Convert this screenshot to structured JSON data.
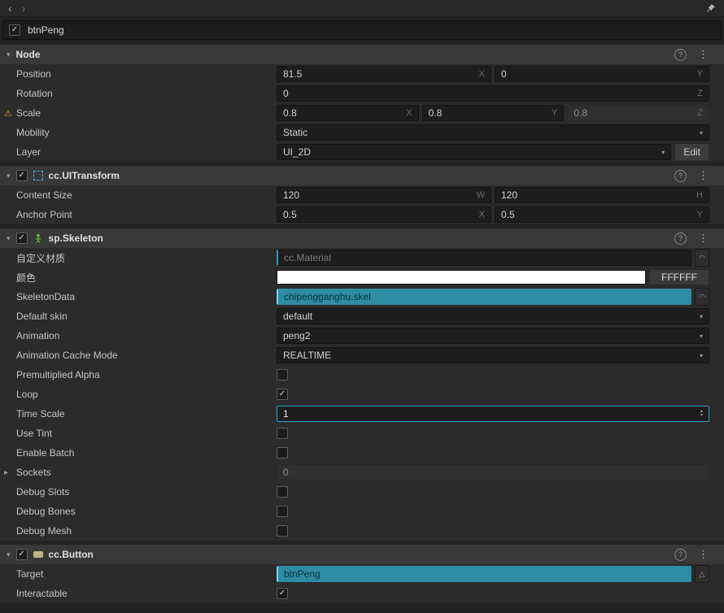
{
  "colors": {
    "accent": "#2aa5c6",
    "asset_reference_bg": "#2e8ca3",
    "warning": "#dba62e",
    "color_swatch": "#ffffff",
    "section_header_bg": "#383838",
    "panel_bg": "#2b2b2b"
  },
  "icons": {
    "back": "‹",
    "forward": "›",
    "chevron_down": "▾",
    "chevron_right": "▸",
    "dots_menu": "⋮",
    "help": "?",
    "check": "✓",
    "warning": "⚠",
    "dropdown_arrow": "▾",
    "stepper_up": "▴",
    "stepper_down": "▾",
    "asset_picker": "◠",
    "node_picker": "△"
  },
  "name_bar": {
    "value": "btnPeng",
    "check": "✓"
  },
  "node": {
    "title": "Node",
    "position": {
      "label": "Position",
      "x": "81.5",
      "sx": "X",
      "y": "0",
      "sy": "Y"
    },
    "rotation": {
      "label": "Rotation",
      "z": "0",
      "sz": "Z"
    },
    "scale": {
      "label": "Scale",
      "x": "0.8",
      "sx": "X",
      "y": "0.8",
      "sy": "Y",
      "z": "0.8",
      "sz": "Z"
    },
    "mobility": {
      "label": "Mobility",
      "value": "Static"
    },
    "layer": {
      "label": "Layer",
      "value": "UI_2D",
      "edit": "Edit"
    }
  },
  "uitransform": {
    "title": "cc.UITransform",
    "check": "✓",
    "content_size": {
      "label": "Content Size",
      "w": "120",
      "sw": "W",
      "h": "120",
      "sh": "H"
    },
    "anchor_point": {
      "label": "Anchor Point",
      "x": "0.5",
      "sx": "X",
      "y": "0.5",
      "sy": "Y"
    }
  },
  "skeleton": {
    "title": "sp.Skeleton",
    "check": "✓",
    "custom_material": {
      "label": "自定义材质",
      "placeholder": "cc.Material"
    },
    "color": {
      "label": "颜色",
      "hex": "FFFFFF"
    },
    "skeleton_data": {
      "label": "SkeletonData",
      "value": "chipengganghu.skel"
    },
    "default_skin": {
      "label": "Default skin",
      "value": "default"
    },
    "animation": {
      "label": "Animation",
      "value": "peng2"
    },
    "cache_mode": {
      "label": "Animation Cache Mode",
      "value": "REALTIME"
    },
    "premultiplied_alpha": {
      "label": "Premultiplied Alpha",
      "check": ""
    },
    "loop": {
      "label": "Loop",
      "check": "✓"
    },
    "time_scale": {
      "label": "Time Scale",
      "value": "1"
    },
    "use_tint": {
      "label": "Use Tint",
      "check": ""
    },
    "enable_batch": {
      "label": "Enable Batch",
      "check": ""
    },
    "sockets": {
      "label": "Sockets",
      "value": "0"
    },
    "debug_slots": {
      "label": "Debug Slots",
      "check": ""
    },
    "debug_bones": {
      "label": "Debug Bones",
      "check": ""
    },
    "debug_mesh": {
      "label": "Debug Mesh",
      "check": ""
    }
  },
  "button": {
    "title": "cc.Button",
    "check": "✓",
    "target": {
      "label": "Target",
      "value": "btnPeng"
    },
    "interactable": {
      "label": "Interactable",
      "check": "✓"
    }
  }
}
